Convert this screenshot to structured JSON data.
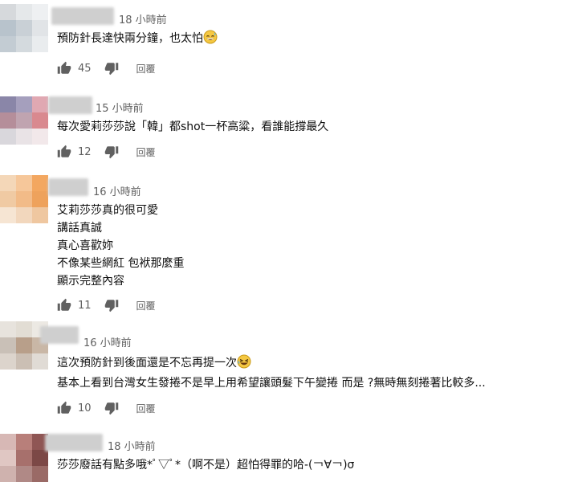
{
  "comments": [
    {
      "time": "18 小時前",
      "lines": [
        "預防針長達快兩分鐘，也太怕"
      ],
      "emoji": "grin-sweat-emoji",
      "likes": "45",
      "reply": "回覆",
      "avatar_colors": [
        "#d6d9dc",
        "#e5e8ea",
        "#eef0f2",
        "#b8c3cc",
        "#c9d0d6",
        "#e1e4e7",
        "#c3ccd3",
        "#d4dade",
        "#e9ecee"
      ]
    },
    {
      "time": "15 小時前",
      "lines": [
        "每次愛莉莎莎說「韓」都shot一杯高粱，看誰能撐最久"
      ],
      "likes": "12",
      "reply": "回覆",
      "avatar_colors": [
        "#8a86a8",
        "#a59fbd",
        "#e0a8b2",
        "#b58e9a",
        "#c0a4b0",
        "#d9898f",
        "#d9d7dc",
        "#e9e3e6",
        "#f2e8ea"
      ]
    },
    {
      "time": "16 小時前",
      "lines": [
        "艾莉莎莎真的很可愛",
        "講話真誠",
        "真心喜歡妳",
        "不像某些網紅 包袱那麼重",
        "顯示完整內容"
      ],
      "likes": "11",
      "reply": "回覆",
      "avatar_colors": [
        "#f4d7b8",
        "#f6c79a",
        "#f3a760",
        "#f0caa3",
        "#f2bb88",
        "#eea25c",
        "#f6e5d3",
        "#f2d7bd",
        "#efc7a0"
      ]
    },
    {
      "time": "16 小時前",
      "lines": [
        "這次預防針到後面還是不忘再提一次",
        "基本上看到台灣女生發捲不是早上用希望讓頭髮下午變捲 而是 ?無時無刻捲著比較多..."
      ],
      "emoji": "laugh-emoji",
      "likes": "10",
      "reply": "回覆",
      "avatar_colors": [
        "#e7e3dd",
        "#e2ddd4",
        "#ece9e3",
        "#c9c0b7",
        "#b89f8a",
        "#c9b7a6",
        "#dcd4cc",
        "#cbbfb4",
        "#e0dbd5"
      ]
    },
    {
      "time": "18 小時前",
      "lines": [
        "莎莎廢話有點多哦*ﾟ▽ﾟ*（啊不是）超怕得罪的哈-(￢∀￢)σ"
      ],
      "likes": "",
      "reply": "",
      "avatar_colors": [
        "#d7b8b5",
        "#b87f7a",
        "#8f5654",
        "#e0c7c3",
        "#a7706c",
        "#7c4846",
        "#cfb2ae",
        "#b08986",
        "#9a6a66"
      ]
    }
  ]
}
